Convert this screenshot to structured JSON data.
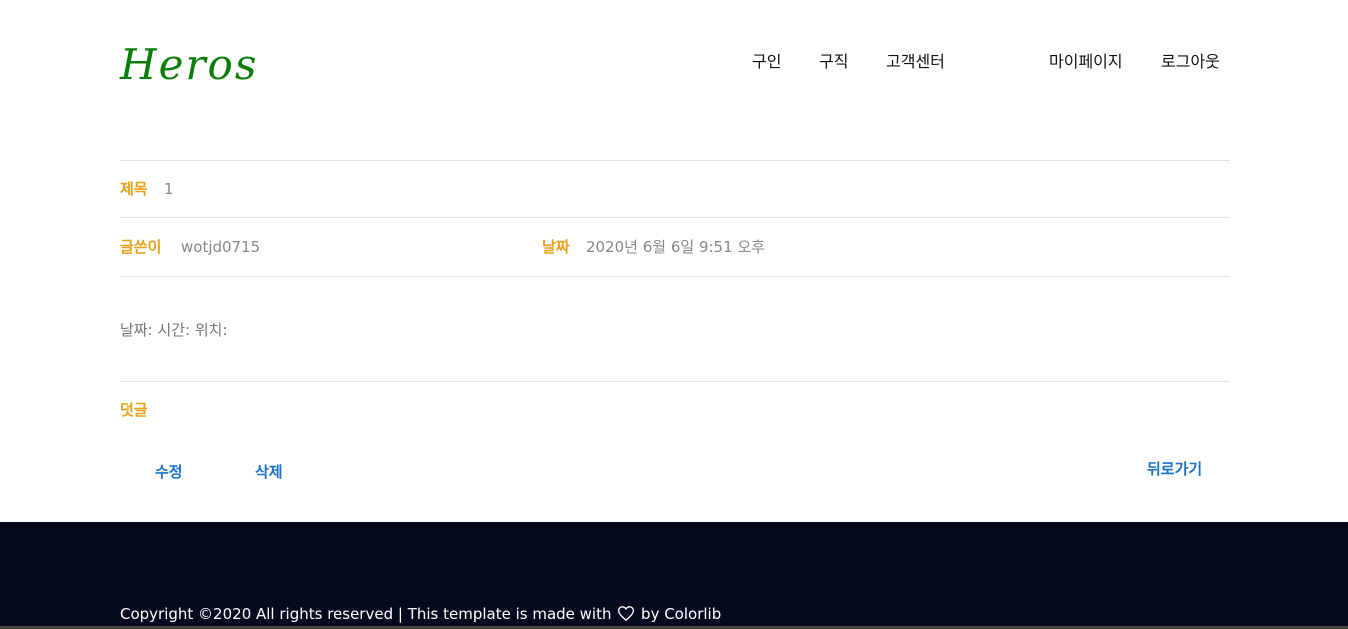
{
  "header": {
    "logo": "Heros",
    "nav": [
      {
        "label": "구인"
      },
      {
        "label": "구직"
      },
      {
        "label": "고객센터"
      },
      {
        "label": "마이페이지"
      },
      {
        "label": "로그아웃"
      }
    ]
  },
  "post": {
    "title_label": "제목",
    "title_value": "1",
    "author_label": "글쓴이",
    "author_value": "wotjd0715",
    "date_label": "날짜",
    "date_value": "2020년 6월 6일 9:51 오후",
    "content": "날짜: 시간: 위치:",
    "comments_label": "덧글"
  },
  "actions": {
    "edit": "수정",
    "delete": "삭제",
    "back": "뒤로가기"
  },
  "footer": {
    "text_before": "Copyright ©2020 All rights reserved | This template is made with",
    "text_after": "by Colorlib"
  },
  "colors": {
    "logo": "#0b7d0b",
    "label": "#e8a21a",
    "action": "#1a73c8",
    "footer_bg": "#050a1e"
  }
}
